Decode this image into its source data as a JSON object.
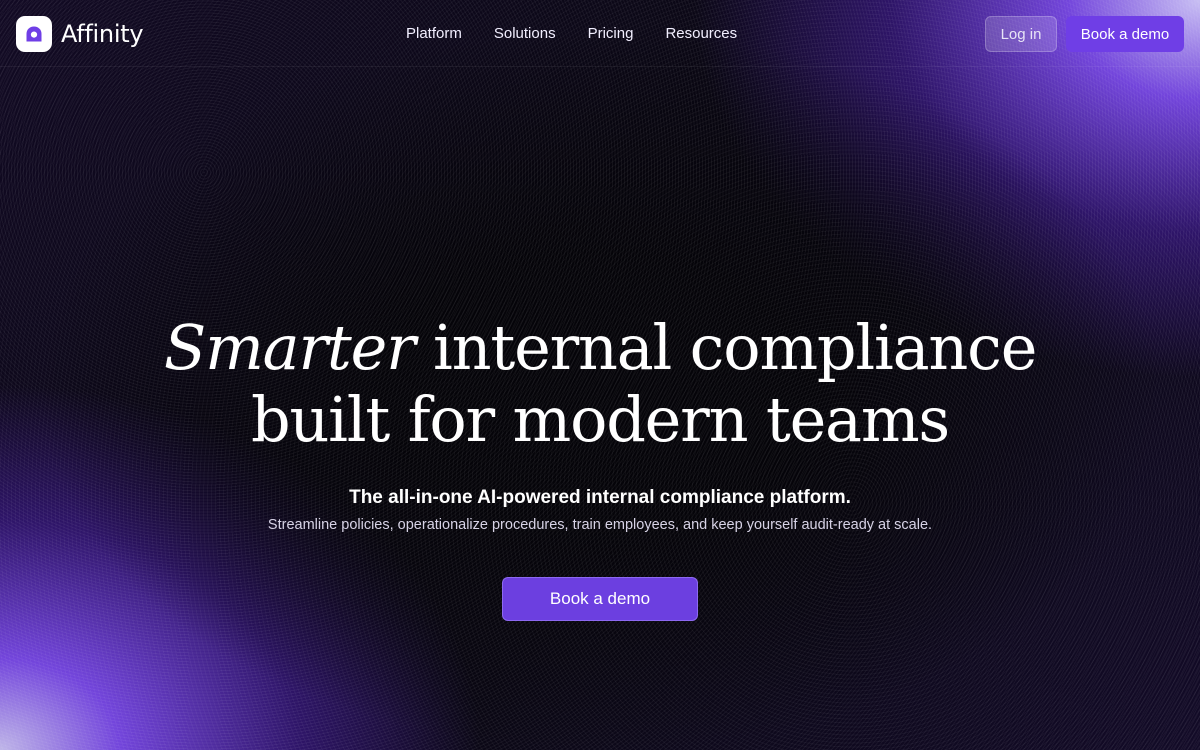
{
  "brand": {
    "name": "Affinity",
    "logo_icon": "affinity-logo-icon"
  },
  "nav": {
    "links": [
      "Platform",
      "Solutions",
      "Pricing",
      "Resources"
    ],
    "login_label": "Log in",
    "demo_label": "Book a demo"
  },
  "hero": {
    "headline_italic": "Smarter",
    "headline_rest": "internal compliance",
    "headline_line2": "built for modern teams",
    "subhead": "The all-in-one AI-powered internal compliance platform.",
    "subtext": "Streamline policies, operationalize procedures, train employees, and keep yourself audit-ready at scale.",
    "cta_label": "Book a demo"
  },
  "colors": {
    "accent": "#6f3ee6",
    "background": "#06050c",
    "glow": "#7848e6"
  }
}
